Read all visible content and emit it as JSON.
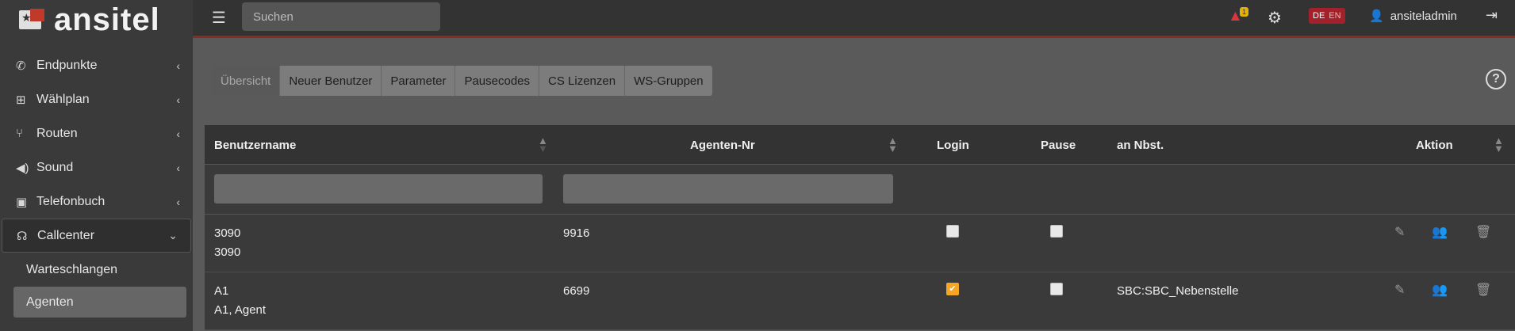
{
  "logo": {
    "text": "ansitel"
  },
  "sidebar": {
    "items": [
      {
        "label": "Endpunkte",
        "icon": "phone-icon"
      },
      {
        "label": "Wählplan",
        "icon": "sitemap-icon"
      },
      {
        "label": "Routen",
        "icon": "branch-icon"
      },
      {
        "label": "Sound",
        "icon": "volume-icon"
      },
      {
        "label": "Telefonbuch",
        "icon": "address-book-icon"
      },
      {
        "label": "Callcenter",
        "icon": "headset-icon"
      }
    ],
    "subitems": [
      {
        "label": "Warteschlangen"
      },
      {
        "label": "Agenten"
      }
    ]
  },
  "topbar": {
    "search_placeholder": "Suchen",
    "alert_count": "1",
    "lang_de": "DE",
    "lang_en": "EN",
    "username": "ansiteladmin"
  },
  "tabs": [
    {
      "label": "Übersicht"
    },
    {
      "label": "Neuer Benutzer"
    },
    {
      "label": "Parameter"
    },
    {
      "label": "Pausecodes"
    },
    {
      "label": "CS Lizenzen"
    },
    {
      "label": "WS-Gruppen"
    }
  ],
  "table": {
    "columns": {
      "username": "Benutzername",
      "agent_no": "Agenten-Nr",
      "login": "Login",
      "pause": "Pause",
      "ext": "an Nbst.",
      "action": "Aktion"
    },
    "rows": [
      {
        "username": "3090",
        "name": "3090",
        "agent_no": "9916",
        "login": false,
        "pause": false,
        "ext": ""
      },
      {
        "username": "A1",
        "name": "A1, Agent",
        "agent_no": "6699",
        "login": true,
        "pause": false,
        "ext": "SBC:SBC_Nebenstelle"
      }
    ]
  },
  "colors": {
    "accent_red": "#c0392b",
    "checkbox_on": "#f5a623",
    "badge_yellow": "#e2b007"
  }
}
